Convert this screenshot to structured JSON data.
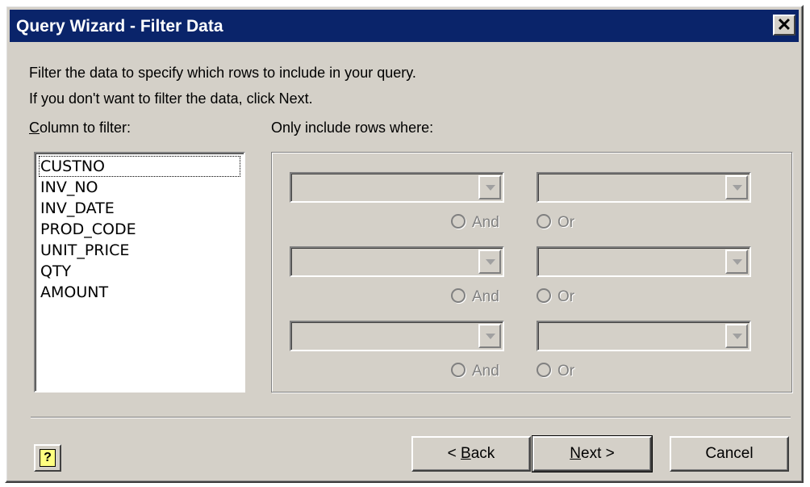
{
  "window": {
    "title": "Query Wizard - Filter Data",
    "close_glyph": "✕"
  },
  "instructions": {
    "line1": "Filter the data to specify which rows to include in your query.",
    "line2": "If you don't want to filter the data, click Next."
  },
  "columns": {
    "label_accel": "C",
    "label_rest": "olumn to filter:",
    "items": [
      "CUSTNO",
      "INV_NO",
      "INV_DATE",
      "PROD_CODE",
      "UNIT_PRICE",
      "QTY",
      "AMOUNT"
    ],
    "focused_index": 0
  },
  "criteria": {
    "label": "Only include rows where:",
    "rows": [
      {
        "operator": "",
        "value": "",
        "and_label": "And",
        "or_label": "Or"
      },
      {
        "operator": "",
        "value": "",
        "and_label": "And",
        "or_label": "Or"
      },
      {
        "operator": "",
        "value": "",
        "and_label": "And",
        "or_label": "Or"
      }
    ]
  },
  "buttons": {
    "help_icon": "help-icon",
    "back_prefix": "< ",
    "back_accel": "B",
    "back_rest": "ack",
    "next_accel": "N",
    "next_rest": "ext >",
    "cancel": "Cancel"
  },
  "colors": {
    "title_bar": "#0a246a",
    "face": "#d4d0c8",
    "disabled_text": "#808080"
  }
}
